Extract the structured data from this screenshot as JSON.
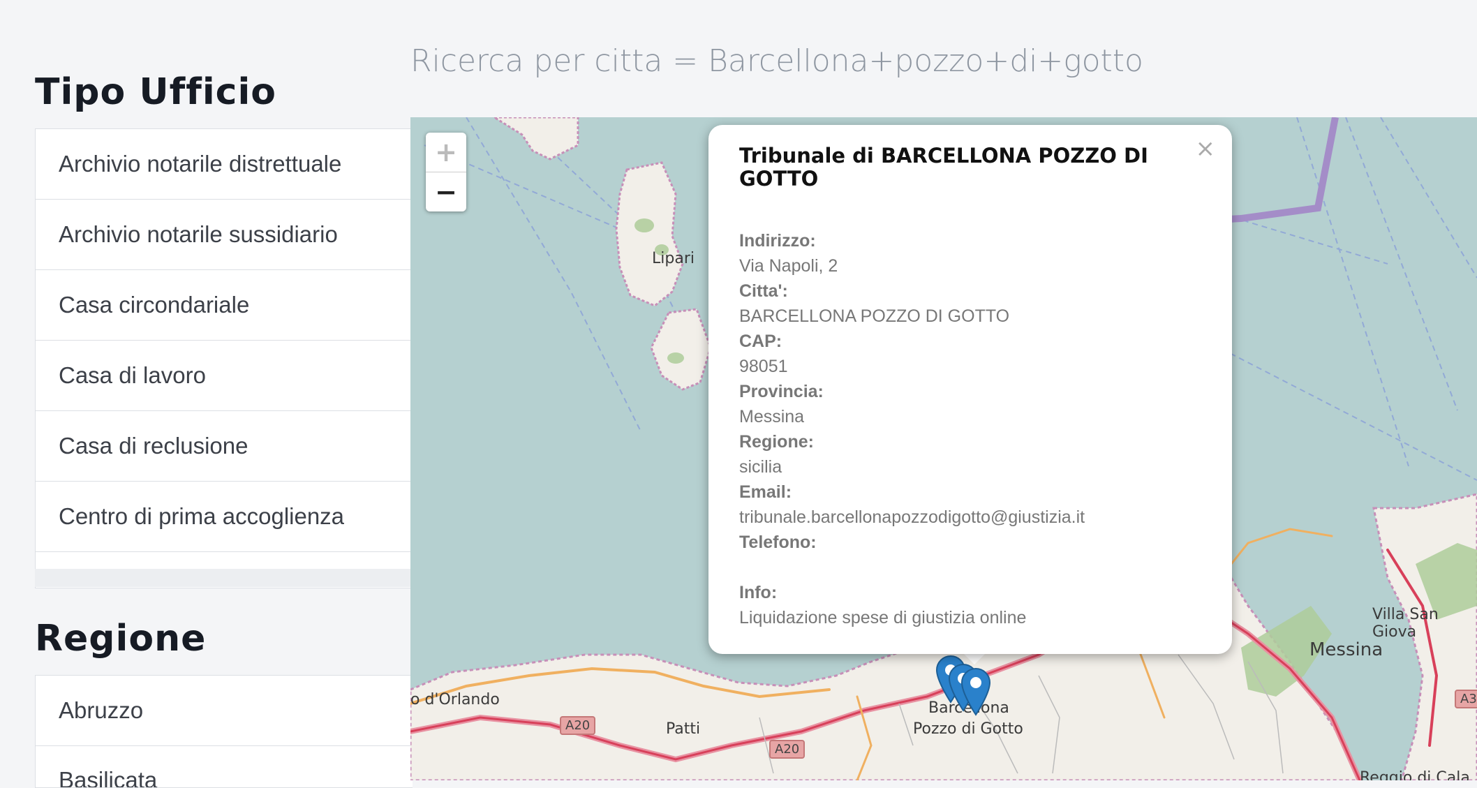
{
  "search": {
    "heading": "Ricerca per citta = Barcellona+pozzo+di+gotto"
  },
  "sidebar": {
    "office_type": {
      "title": "Tipo Ufficio",
      "items": [
        {
          "label": "Archivio notarile distrettuale"
        },
        {
          "label": "Archivio notarile sussidiario"
        },
        {
          "label": "Casa circondariale"
        },
        {
          "label": "Casa di lavoro"
        },
        {
          "label": "Casa di reclusione"
        },
        {
          "label": "Centro di prima accoglienza"
        }
      ]
    },
    "region": {
      "title": "Regione",
      "items": [
        {
          "label": "Abruzzo"
        },
        {
          "label": "Basilicata"
        }
      ]
    }
  },
  "map": {
    "zoom_in": "+",
    "zoom_out": "−",
    "labels": {
      "lipari": "Lipari",
      "orlando": "o d'Orlando",
      "patti": "Patti",
      "barcellona_1": "Barcellona",
      "barcellona_2": "Pozzo di Gotto",
      "messina": "Messina",
      "villa_san_giovanni": "Villa San Giova",
      "reggio": "Reggio di Cala"
    },
    "roads": {
      "a20_1": "A20",
      "a20_2": "A20",
      "a3": "A3"
    },
    "marker_color": "#2a81cb",
    "sea_color": "#b5d0d0",
    "land_color": "#f2efe9"
  },
  "popup": {
    "title": "Tribunale di BARCELLONA POZZO DI GOTTO",
    "close": "×",
    "fields": {
      "indirizzo_label": "Indirizzo:",
      "indirizzo_value": "Via Napoli, 2",
      "citta_label": "Citta':",
      "citta_value": "BARCELLONA POZZO DI GOTTO",
      "cap_label": "CAP:",
      "cap_value": "98051",
      "provincia_label": "Provincia:",
      "provincia_value": "Messina",
      "regione_label": "Regione:",
      "regione_value": "sicilia",
      "email_label": "Email:",
      "email_value": "tribunale.barcellonapozzodigotto@giustizia.it",
      "telefono_label": "Telefono:",
      "telefono_value": "",
      "info_label": "Info:",
      "info_value": "Liquidazione spese di giustizia online"
    }
  }
}
